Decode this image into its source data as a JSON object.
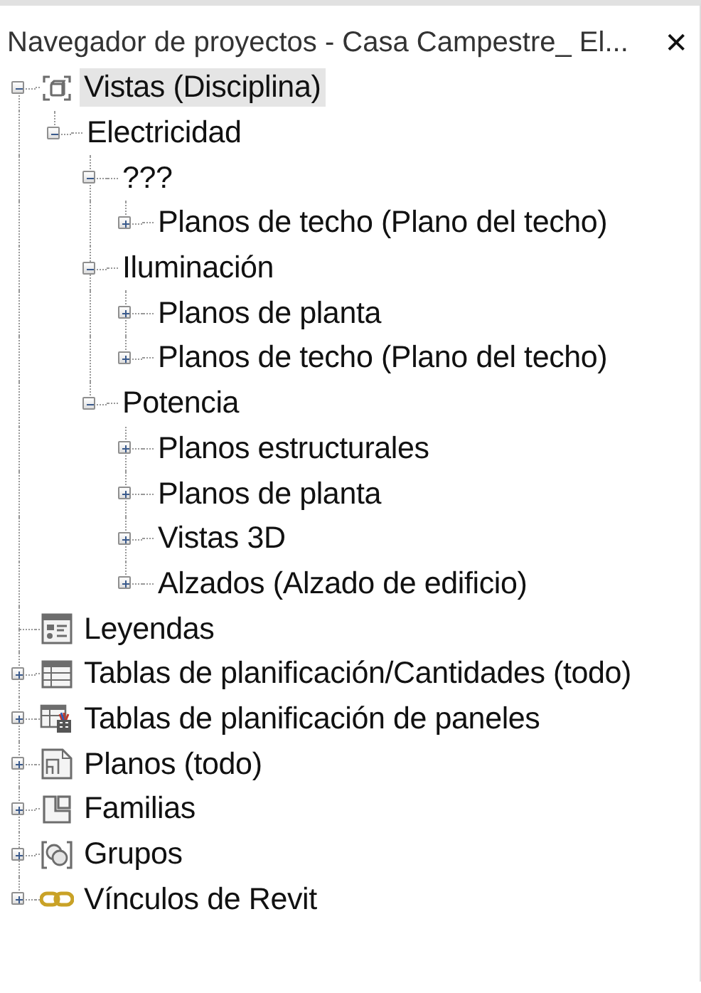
{
  "panel": {
    "title": "Navegador de proyectos - Casa Campestre_ El...",
    "close": "✕"
  },
  "tree": [
    {
      "label": "Vistas (Disciplina)",
      "kind": "views",
      "expandable": true,
      "expanded": true,
      "selected": true,
      "children": [
        {
          "label": "Electricidad",
          "expandable": true,
          "expanded": true,
          "selected": false,
          "children": [
            {
              "label": "???",
              "expandable": true,
              "expanded": true,
              "selected": false,
              "children": [
                {
                  "label": "Planos de techo (Plano del techo)",
                  "expandable": true,
                  "expanded": false,
                  "selected": false
                }
              ]
            },
            {
              "label": "Iluminación",
              "expandable": true,
              "expanded": true,
              "selected": false,
              "children": [
                {
                  "label": "Planos de planta",
                  "expandable": true,
                  "expanded": false,
                  "selected": false
                },
                {
                  "label": "Planos de techo (Plano del techo)",
                  "expandable": true,
                  "expanded": false,
                  "selected": false
                }
              ]
            },
            {
              "label": "Potencia",
              "expandable": true,
              "expanded": true,
              "selected": false,
              "children": [
                {
                  "label": "Planos estructurales",
                  "expandable": true,
                  "expanded": false,
                  "selected": false
                },
                {
                  "label": "Planos de planta",
                  "expandable": true,
                  "expanded": false,
                  "selected": false
                },
                {
                  "label": "Vistas 3D",
                  "expandable": true,
                  "expanded": false,
                  "selected": false
                },
                {
                  "label": "Alzados (Alzado de edificio)",
                  "expandable": true,
                  "expanded": false,
                  "selected": false
                }
              ]
            }
          ]
        }
      ]
    },
    {
      "label": "Leyendas",
      "kind": "legend",
      "expandable": false,
      "expanded": false,
      "selected": false
    },
    {
      "label": "Tablas de planificación/Cantidades (todo)",
      "kind": "schedule",
      "expandable": true,
      "expanded": false,
      "selected": false
    },
    {
      "label": "Tablas de planificación de paneles",
      "kind": "panel-schedule",
      "expandable": true,
      "expanded": false,
      "selected": false
    },
    {
      "label": "Planos (todo)",
      "kind": "sheets",
      "expandable": true,
      "expanded": false,
      "selected": false
    },
    {
      "label": "Familias",
      "kind": "families",
      "expandable": true,
      "expanded": false,
      "selected": false
    },
    {
      "label": "Grupos",
      "kind": "groups",
      "expandable": true,
      "expanded": false,
      "selected": false
    },
    {
      "label": "Vínculos de Revit",
      "kind": "links",
      "expandable": true,
      "expanded": false,
      "selected": false
    }
  ]
}
